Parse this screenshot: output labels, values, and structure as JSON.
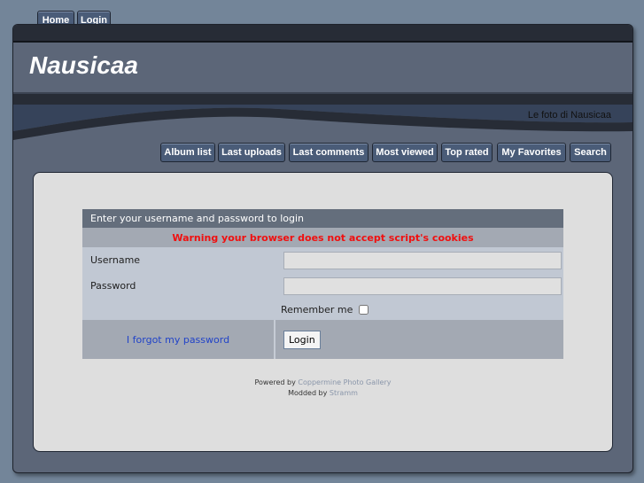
{
  "top_nav": [
    {
      "label": "Home"
    },
    {
      "label": "Login"
    }
  ],
  "header": {
    "title": "Nausicaa",
    "subtitle": "Le foto di Nausicaa"
  },
  "main_nav": [
    {
      "label": "Album list"
    },
    {
      "label": "Last uploads"
    },
    {
      "label": "Last comments"
    },
    {
      "label": "Most viewed"
    },
    {
      "label": "Top rated"
    },
    {
      "label": "My Favorites"
    },
    {
      "label": "Search"
    }
  ],
  "login": {
    "heading": "Enter your username and password to login",
    "warning": "Warning your browser does not accept script's cookies",
    "username_label": "Username",
    "username_value": "",
    "password_label": "Password",
    "password_value": "",
    "remember_label": "Remember me",
    "forgot_link": "I forgot my password",
    "login_button": "Login"
  },
  "footer": {
    "powered_by": "Powered by",
    "powered_link": "Coppermine Photo Gallery",
    "modded_by": "Modded by",
    "modded_link": "Stramm"
  }
}
